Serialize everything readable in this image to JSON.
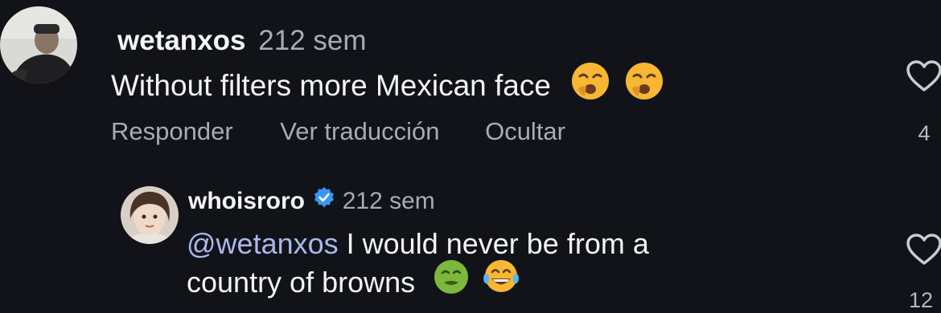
{
  "comments": [
    {
      "username": "wetanxos",
      "time": "212 sem",
      "text": "Without filters more Mexican face",
      "emojis": [
        "weary-face-emoji",
        "weary-face-emoji"
      ],
      "actions": {
        "reply": "Responder",
        "translate": "Ver traducción",
        "hide": "Ocultar"
      },
      "like_count": "4"
    },
    {
      "username": "whoisroro",
      "verified": true,
      "time": "212 sem",
      "mention": "@wetanxos",
      "text_line1": "I would never be from a",
      "text_line2": "country of browns",
      "emojis": [
        "nauseated-face-emoji",
        "tears-of-joy-emoji"
      ],
      "like_count": "12"
    }
  ],
  "colors": {
    "background": "#111318",
    "text": "#f4f5f7",
    "secondary": "#a8abb2",
    "mention": "#a9b9ea",
    "verified": "#3797f0"
  },
  "icons": [
    "heart-outline-icon",
    "verified-badge-icon"
  ]
}
